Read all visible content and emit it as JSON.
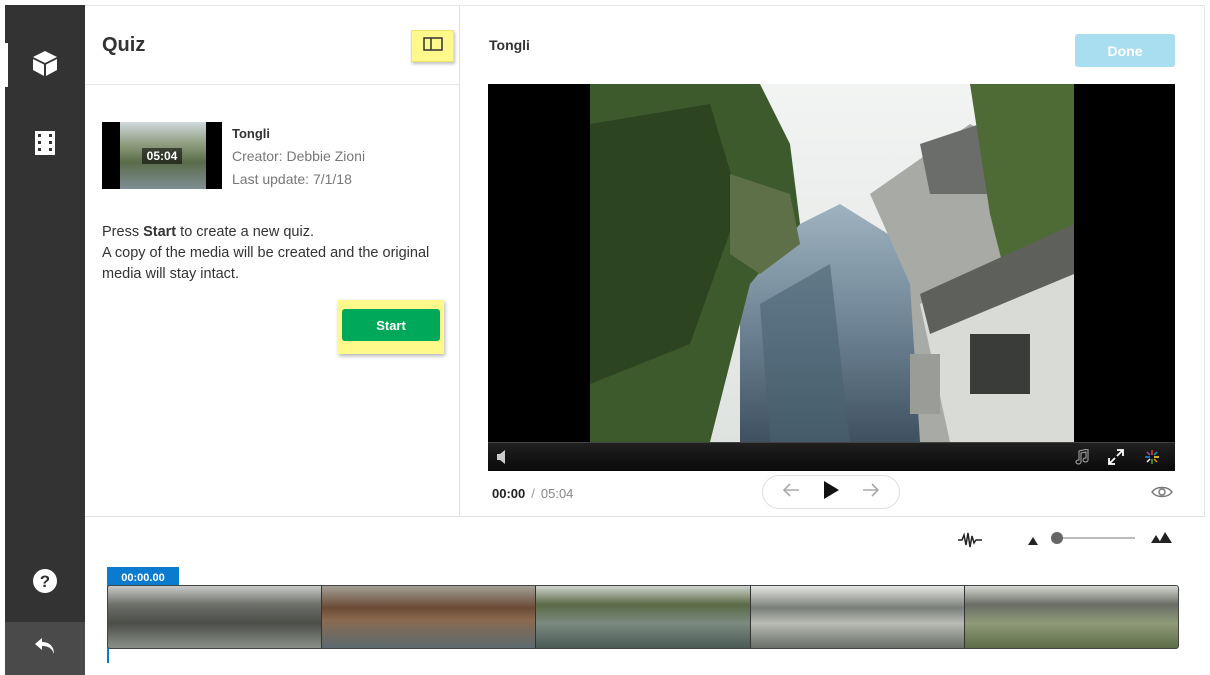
{
  "quiz": {
    "title": "Quiz"
  },
  "media": {
    "duration_badge": "05:04",
    "name": "Tongli",
    "creator": "Creator: Debbie Zioni",
    "last_update": "Last update: 7/1/18"
  },
  "description": {
    "press": "Press ",
    "start_word": "Start",
    "rest1": " to create a new quiz.",
    "line2": "A copy of the media will be created and the original media will stay intact."
  },
  "buttons": {
    "start": "Start",
    "done": "Done"
  },
  "video": {
    "title": "Tongli",
    "current_time": "00:00",
    "separator": "/",
    "total_time": "05:04"
  },
  "timeline": {
    "cursor_label": "00:00.00"
  },
  "icons": {
    "rail_top": "cube-icon",
    "rail_second": "filmstrip-icon",
    "help": "help-icon",
    "back": "undo-icon",
    "layout": "split-layout-icon",
    "prev": "arrow-left-icon",
    "play": "play-icon",
    "next": "arrow-right-icon",
    "eye": "eye-icon",
    "waveform": "waveform-icon",
    "zoom_out": "small-mountain-icon",
    "zoom_in": "large-mountain-icon"
  },
  "colors": {
    "rail": "#333333",
    "highlight": "#fff88a",
    "start_green": "#00a85a",
    "done_disabled": "#a9def0",
    "timeline_blue": "#0a7bcf"
  }
}
